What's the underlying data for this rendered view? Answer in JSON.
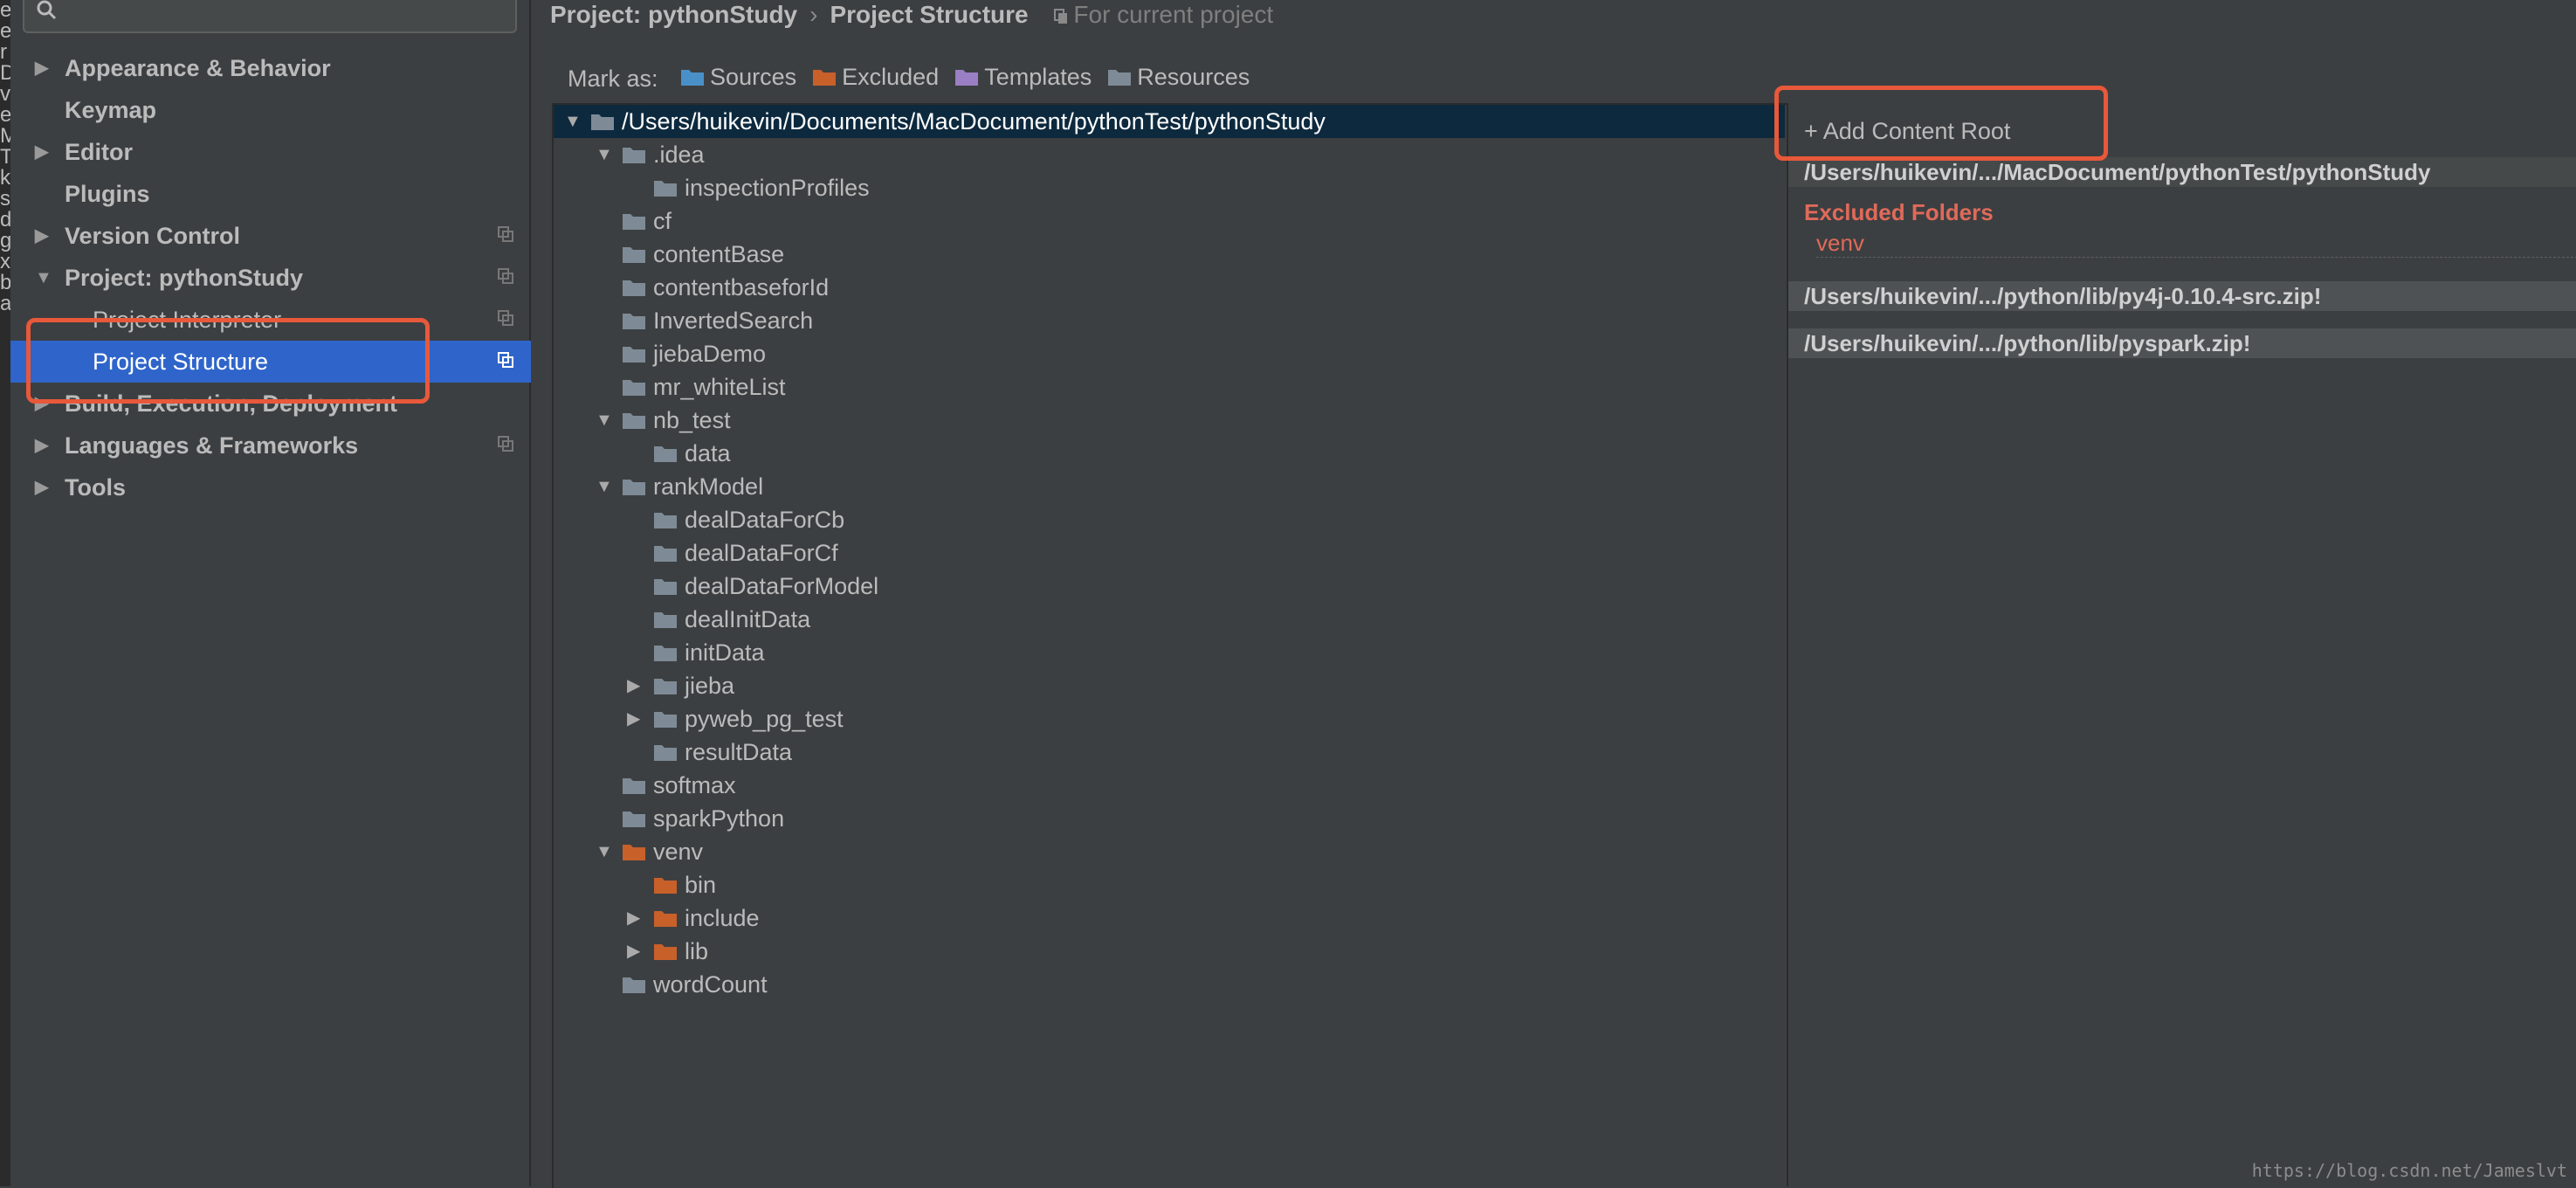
{
  "left_edge": [
    "e",
    "e",
    "r",
    "D",
    "v",
    "e",
    "M",
    "T",
    "k",
    "s",
    "d",
    "g",
    "x",
    "b",
    "a"
  ],
  "sidebar": {
    "search_placeholder": "",
    "items": [
      {
        "label": "Appearance & Behavior",
        "arrow": "▶",
        "level": 0
      },
      {
        "label": "Keymap",
        "arrow": "",
        "level": 0
      },
      {
        "label": "Editor",
        "arrow": "▶",
        "level": 0
      },
      {
        "label": "Plugins",
        "arrow": "",
        "level": 0
      },
      {
        "label": "Version Control",
        "arrow": "▶",
        "level": 0
      },
      {
        "label": "Project: pythonStudy",
        "arrow": "▼",
        "level": 0
      },
      {
        "label": "Project Interpreter",
        "arrow": "",
        "level": 1
      },
      {
        "label": "Project Structure",
        "arrow": "",
        "level": 1,
        "selected": true
      },
      {
        "label": "Build, Execution, Deployment",
        "arrow": "▶",
        "level": 0
      },
      {
        "label": "Languages & Frameworks",
        "arrow": "▶",
        "level": 0
      },
      {
        "label": "Tools",
        "arrow": "▶",
        "level": 0
      }
    ]
  },
  "breadcrumb": {
    "project": "Project: pythonStudy",
    "separator": "›",
    "page": "Project Structure",
    "scope": "For current project"
  },
  "mark_as": {
    "label": "Mark as:",
    "options": [
      {
        "label": "Sources",
        "color": "#4a90c8"
      },
      {
        "label": "Excluded",
        "color": "#c8602a"
      },
      {
        "label": "Templates",
        "color": "#9a7fc4"
      },
      {
        "label": "Resources",
        "color": "#7e8b96"
      }
    ]
  },
  "tree": [
    {
      "name": "/Users/huikevin/Documents/MacDocument/pythonTest/pythonStudy",
      "depth": 0,
      "toggle": "▼",
      "selected": true,
      "color": "#7e8b96"
    },
    {
      "name": ".idea",
      "depth": 1,
      "toggle": "▼",
      "color": "#7e8b96"
    },
    {
      "name": "inspectionProfiles",
      "depth": 2,
      "toggle": "",
      "color": "#7e8b96"
    },
    {
      "name": "cf",
      "depth": 1,
      "toggle": "",
      "color": "#7e8b96"
    },
    {
      "name": "contentBase",
      "depth": 1,
      "toggle": "",
      "color": "#7e8b96"
    },
    {
      "name": "contentbaseforId",
      "depth": 1,
      "toggle": "",
      "color": "#7e8b96"
    },
    {
      "name": "InvertedSearch",
      "depth": 1,
      "toggle": "",
      "color": "#7e8b96"
    },
    {
      "name": "jiebaDemo",
      "depth": 1,
      "toggle": "",
      "color": "#7e8b96"
    },
    {
      "name": "mr_whiteList",
      "depth": 1,
      "toggle": "",
      "color": "#7e8b96"
    },
    {
      "name": "nb_test",
      "depth": 1,
      "toggle": "▼",
      "color": "#7e8b96"
    },
    {
      "name": "data",
      "depth": 2,
      "toggle": "",
      "color": "#7e8b96"
    },
    {
      "name": "rankModel",
      "depth": 1,
      "toggle": "▼",
      "color": "#7e8b96"
    },
    {
      "name": "dealDataForCb",
      "depth": 2,
      "toggle": "",
      "color": "#7e8b96"
    },
    {
      "name": "dealDataForCf",
      "depth": 2,
      "toggle": "",
      "color": "#7e8b96"
    },
    {
      "name": "dealDataForModel",
      "depth": 2,
      "toggle": "",
      "color": "#7e8b96"
    },
    {
      "name": "dealInitData",
      "depth": 2,
      "toggle": "",
      "color": "#7e8b96"
    },
    {
      "name": "initData",
      "depth": 2,
      "toggle": "",
      "color": "#7e8b96"
    },
    {
      "name": "jieba",
      "depth": 2,
      "toggle": "▶",
      "color": "#7e8b96"
    },
    {
      "name": "pyweb_pg_test",
      "depth": 2,
      "toggle": "▶",
      "color": "#7e8b96"
    },
    {
      "name": "resultData",
      "depth": 2,
      "toggle": "",
      "color": "#7e8b96"
    },
    {
      "name": "softmax",
      "depth": 1,
      "toggle": "",
      "color": "#7e8b96"
    },
    {
      "name": "sparkPython",
      "depth": 1,
      "toggle": "",
      "color": "#7e8b96"
    },
    {
      "name": "venv",
      "depth": 1,
      "toggle": "▼",
      "color": "#c8602a"
    },
    {
      "name": "bin",
      "depth": 2,
      "toggle": "",
      "color": "#c8602a"
    },
    {
      "name": "include",
      "depth": 2,
      "toggle": "▶",
      "color": "#c8602a"
    },
    {
      "name": "lib",
      "depth": 2,
      "toggle": "▶",
      "color": "#c8602a"
    },
    {
      "name": "wordCount",
      "depth": 1,
      "toggle": "",
      "color": "#7e8b96"
    }
  ],
  "content_roots": {
    "add_label": "+ Add Content Root",
    "main_root": "/Users/huikevin/.../MacDocument/pythonTest/pythonStudy",
    "excluded_title": "Excluded Folders",
    "excluded_items": [
      "venv"
    ],
    "other_roots": [
      "/Users/huikevin/.../python/lib/py4j-0.10.4-src.zip!",
      "/Users/huikevin/.../python/lib/pyspark.zip!"
    ]
  },
  "watermark": "https://blog.csdn.net/Jameslvt",
  "accent_colors": {
    "selection": "#2f65ca",
    "highlight_box": "#e8583a",
    "excluded": "#e06a5a"
  }
}
